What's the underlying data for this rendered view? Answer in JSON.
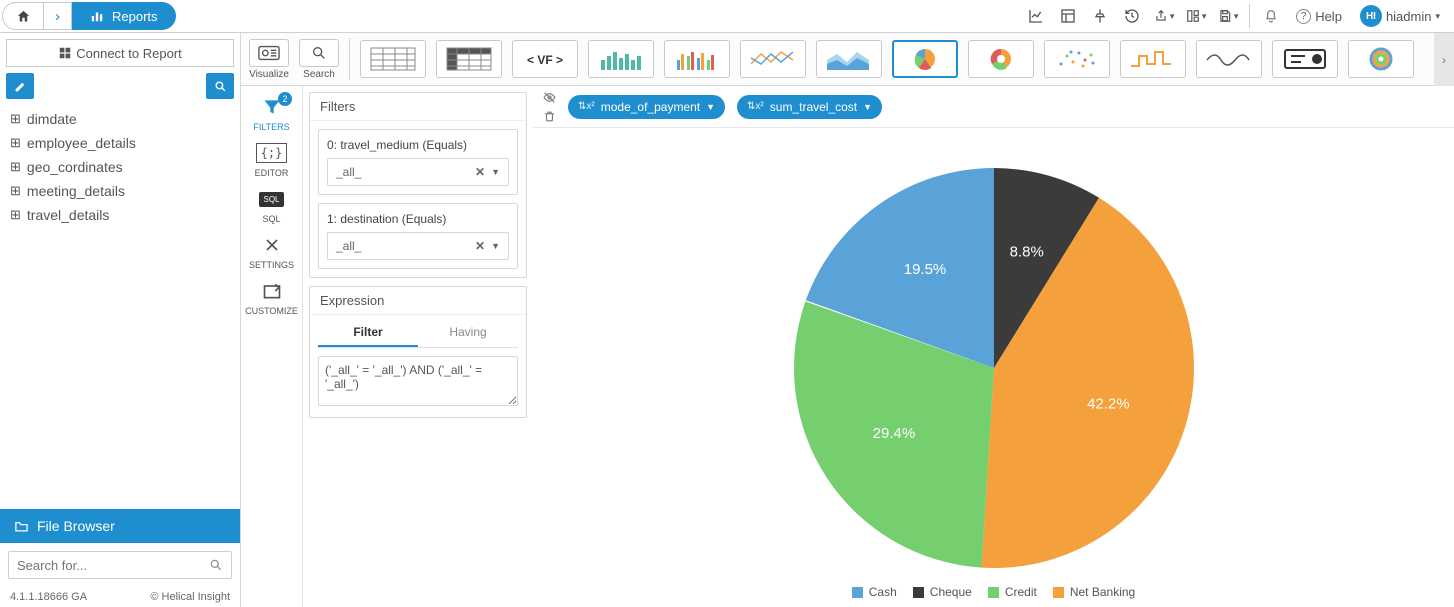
{
  "breadcrumb": {
    "reports_label": "Reports"
  },
  "top_right": {
    "help": "Help",
    "user": "hiadmin",
    "user_badge": "HI"
  },
  "left": {
    "connect": "Connect to Report",
    "tables": [
      "dimdate",
      "employee_details",
      "geo_cordinates",
      "meeting_details",
      "travel_details"
    ],
    "file_browser": "File Browser",
    "search_placeholder": "Search for...",
    "version": "4.1.1.18666 GA",
    "copyright": "© Helical Insight"
  },
  "vis": {
    "visualize": "Visualize",
    "search": "Search"
  },
  "tools": {
    "filters": {
      "label": "FILTERS",
      "badge": "2"
    },
    "editor": "EDITOR",
    "sql": "SQL",
    "settings": "SETTINGS",
    "customize": "CUSTOMIZE"
  },
  "filters": {
    "title": "Filters",
    "items": [
      {
        "label": "0: travel_medium (Equals)",
        "value": "_all_"
      },
      {
        "label": "1: destination (Equals)",
        "value": "_all_"
      }
    ],
    "expression_title": "Expression",
    "tab_filter": "Filter",
    "tab_having": "Having",
    "expression_text": "('_all_' = '_all_') AND ('_all_' = '_all_')"
  },
  "pills": {
    "mode": "mode_of_payment",
    "sum": "sum_travel_cost"
  },
  "chart_data": {
    "type": "pie",
    "title": "",
    "series": [
      {
        "name": "Cash",
        "value": 19.5,
        "color": "#5aa3d8"
      },
      {
        "name": "Cheque",
        "value": 8.8,
        "color": "#3b3b3b"
      },
      {
        "name": "Net Banking",
        "value": 42.2,
        "color": "#f4a03c"
      },
      {
        "name": "Credit",
        "value": 29.4,
        "color": "#75cf6f"
      }
    ],
    "label_order": [
      "Cash",
      "Cheque",
      "Credit",
      "Net Banking"
    ]
  }
}
